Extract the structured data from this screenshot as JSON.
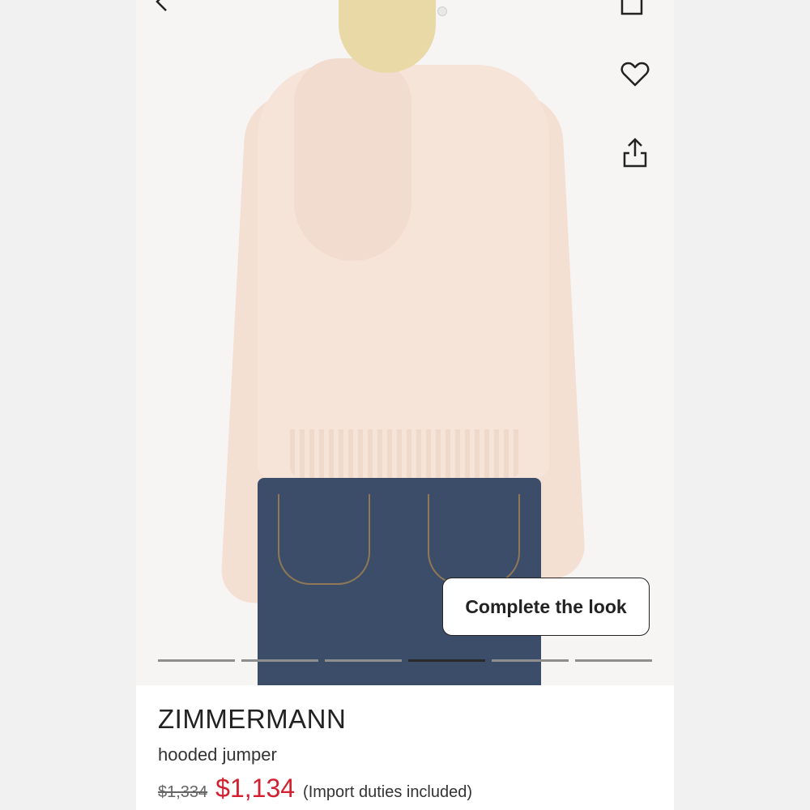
{
  "actions": {
    "cta_label": "Complete the look"
  },
  "gallery": {
    "image_count": 6,
    "active_index": 3
  },
  "product": {
    "brand": "ZIMMERMANN",
    "name": "hooded jumper",
    "original_price": "$1,334",
    "sale_price": "$1,134",
    "duties_note": "(Import duties included)"
  },
  "icons": [
    "back-icon",
    "bag-icon",
    "heart-icon",
    "share-icon"
  ],
  "colors": {
    "sale_price": "#d32030",
    "text": "#222222",
    "pager_active": "#2a2a2a",
    "pager_inactive": "#8e8e8e"
  }
}
